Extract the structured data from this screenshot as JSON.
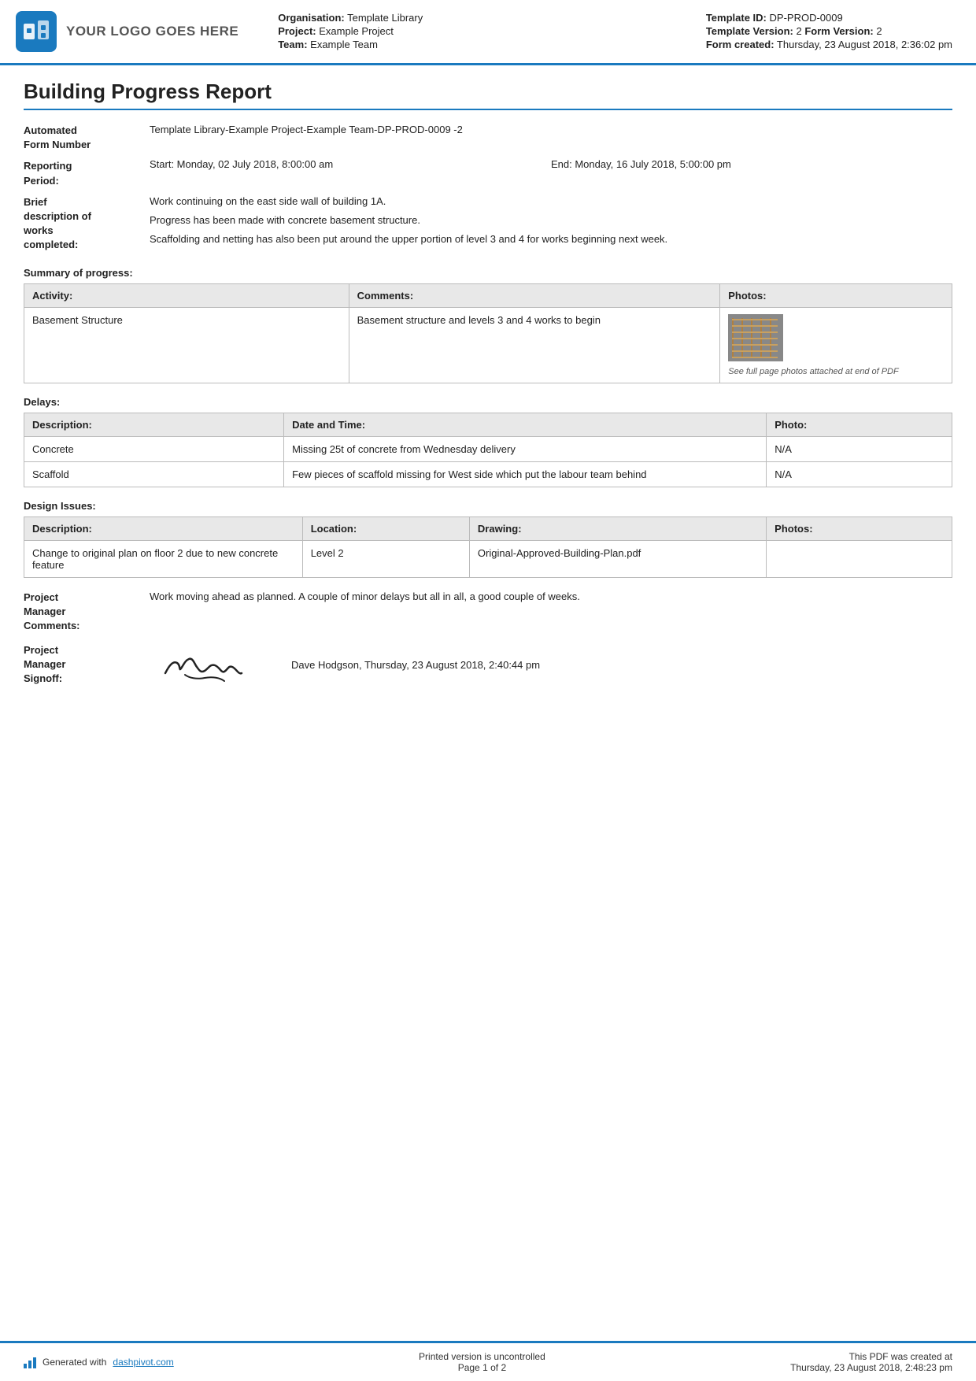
{
  "header": {
    "logo_text": "YOUR LOGO GOES HERE",
    "org_label": "Organisation:",
    "org_value": "Template Library",
    "project_label": "Project:",
    "project_value": "Example Project",
    "team_label": "Team:",
    "team_value": "Example Team",
    "template_id_label": "Template ID:",
    "template_id_value": "DP-PROD-0009",
    "template_version_label": "Template Version:",
    "template_version_value": "2",
    "form_version_label": "Form Version:",
    "form_version_value": "2",
    "form_created_label": "Form created:",
    "form_created_value": "Thursday, 23 August 2018, 2:36:02 pm"
  },
  "report": {
    "title": "Building Progress Report",
    "form_number_label": "Automated\nForm Number",
    "form_number_value": "Template Library-Example Project-Example Team-DP-PROD-0009   -2",
    "reporting_period_label": "Reporting\nPeriod:",
    "reporting_period_start": "Start: Monday, 02 July 2018, 8:00:00 am",
    "reporting_period_end": "End: Monday, 16 July 2018, 5:00:00 pm",
    "brief_desc_label": "Brief\ndescription of\nworks\ncompleted:",
    "brief_desc_lines": [
      "Work continuing on the east side wall of building 1A.",
      "Progress has been made with concrete basement structure.",
      "Scaffolding and netting has also been put around the upper portion of level 3 and 4 for works beginning next week."
    ]
  },
  "summary": {
    "section_title": "Summary of progress:",
    "table_headers": [
      "Activity:",
      "Comments:",
      "Photos:"
    ],
    "rows": [
      {
        "activity": "Basement Structure",
        "comments": "Basement structure and levels 3 and 4 works to begin",
        "has_photo": true,
        "photo_caption": "See full page photos attached at end of PDF"
      }
    ]
  },
  "delays": {
    "section_title": "Delays:",
    "table_headers": [
      "Description:",
      "Date and Time:",
      "Photo:"
    ],
    "rows": [
      {
        "description": "Concrete",
        "datetime": "Missing 25t of concrete from Wednesday delivery",
        "photo": "N/A"
      },
      {
        "description": "Scaffold",
        "datetime": "Few pieces of scaffold missing for West side which put the labour team behind",
        "photo": "N/A"
      }
    ]
  },
  "design_issues": {
    "section_title": "Design Issues:",
    "table_headers": [
      "Description:",
      "Location:",
      "Drawing:",
      "Photos:"
    ],
    "rows": [
      {
        "description": "Change to original plan on floor 2 due to new concrete feature",
        "location": "Level 2",
        "drawing": "Original-Approved-Building-Plan.pdf",
        "photos": ""
      }
    ]
  },
  "project_manager": {
    "comments_label": "Project\nManager\nComments:",
    "comments_value": "Work moving ahead as planned. A couple of minor delays but all in all, a good couple of weeks.",
    "signoff_label": "Project\nManager\nSignoff:",
    "signoff_name": "Dave Hodgson, Thursday, 23 August 2018, 2:40:44 pm"
  },
  "footer": {
    "generated_text": "Generated with",
    "generated_link": "dashpivot.com",
    "uncontrolled_text": "Printed version is uncontrolled",
    "page_label": "Page",
    "page_current": "1",
    "page_of": "of 2",
    "created_text": "This PDF was created at",
    "created_value": "Thursday, 23 August 2018, 2:48:23 pm"
  }
}
